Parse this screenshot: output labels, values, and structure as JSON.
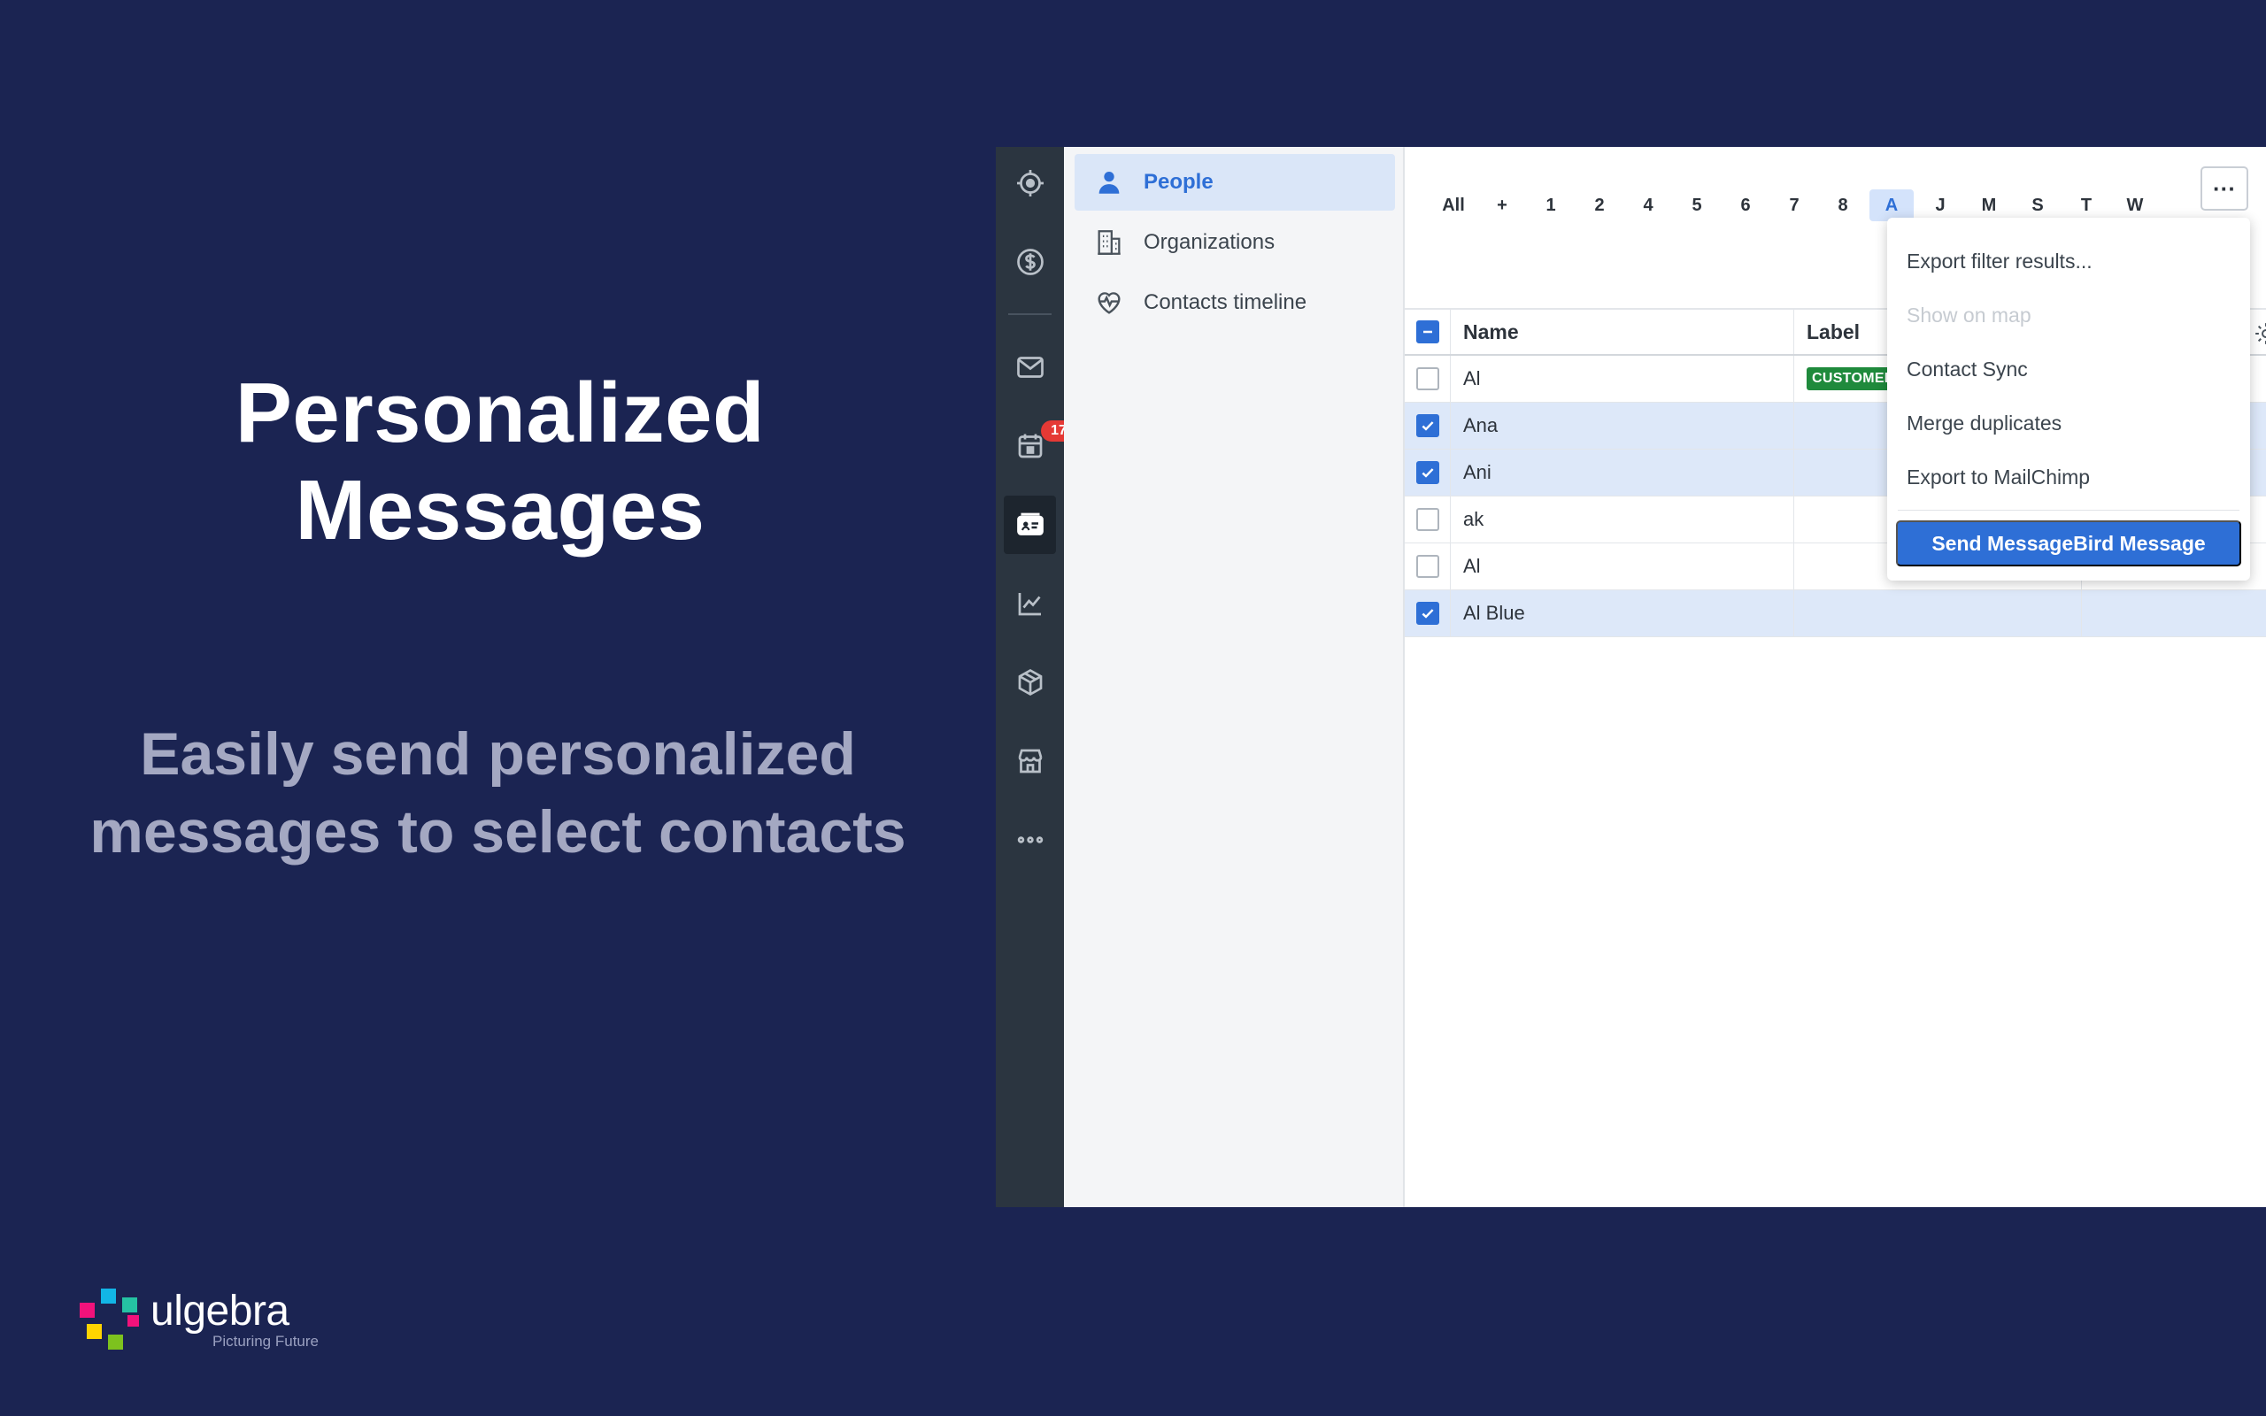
{
  "hero": {
    "title": "Personalized Messages",
    "subtitle": "Easily send personalized messages to select contacts"
  },
  "brand": {
    "name": "ulgebra",
    "tagline": "Picturing Future",
    "colors": [
      "#f2127b",
      "#12b5e6",
      "#25c2a3",
      "#ffd400",
      "#7dc21e"
    ]
  },
  "rail": {
    "items": [
      {
        "icon": "target-icon"
      },
      {
        "icon": "dollar-icon"
      },
      {
        "icon": "mail-icon"
      },
      {
        "icon": "calendar-icon",
        "badge": "17"
      },
      {
        "icon": "contacts-card-icon",
        "active": true
      },
      {
        "icon": "chart-icon"
      },
      {
        "icon": "box-icon"
      },
      {
        "icon": "store-icon"
      },
      {
        "icon": "more-dots-icon"
      }
    ]
  },
  "subnav": {
    "items": [
      {
        "label": "People",
        "icon": "person-icon",
        "active": true
      },
      {
        "label": "Organizations",
        "icon": "building-icon"
      },
      {
        "label": "Contacts timeline",
        "icon": "heartbeat-icon"
      }
    ]
  },
  "filter": {
    "letters": [
      "All",
      "+",
      "1",
      "2",
      "4",
      "5",
      "6",
      "7",
      "8",
      "A",
      "J",
      "M",
      "S",
      "T",
      "W"
    ],
    "active": "A"
  },
  "table": {
    "columns": {
      "name": "Name",
      "label": "Label"
    },
    "rows": [
      {
        "name": "Al",
        "label": "CUSTOMER",
        "checked": false
      },
      {
        "name": "Ana",
        "label": "",
        "checked": true
      },
      {
        "name": "Ani",
        "label": "",
        "checked": true
      },
      {
        "name": "ak",
        "label": "",
        "checked": false
      },
      {
        "name": "Al",
        "label": "",
        "checked": false
      },
      {
        "name": "Al Blue",
        "label": "",
        "checked": true
      }
    ]
  },
  "menu": {
    "more_label": "···",
    "items": [
      "Export filter results...",
      "Show on map",
      "Contact Sync",
      "Merge duplicates",
      "Export to MailChimp"
    ],
    "primary": "Send MessageBird Message"
  },
  "colors": {
    "background": "#1b2452",
    "accent": "#2e6fd6",
    "customer_tag": "#1f8a3c",
    "badge": "#e53935"
  }
}
